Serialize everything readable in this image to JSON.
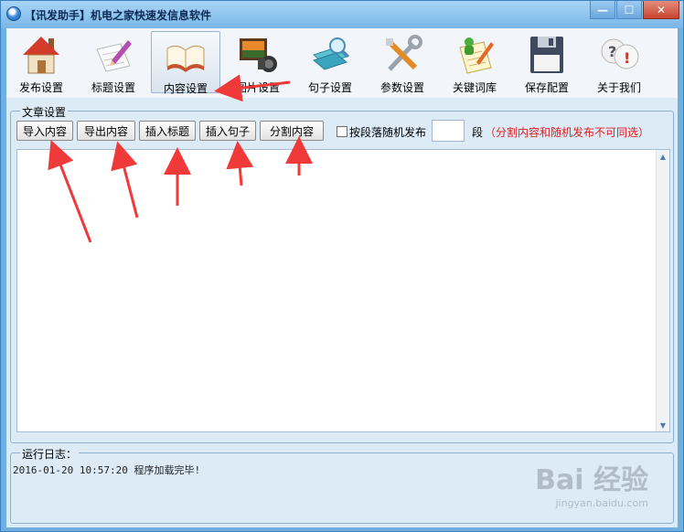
{
  "window": {
    "title": "【讯发助手】机电之家快速发信息软件",
    "controls": {
      "minimize": "—",
      "maximize": "☐",
      "close": "✕"
    }
  },
  "toolbar": {
    "items": [
      {
        "label": "发布设置",
        "icon": "house-icon"
      },
      {
        "label": "标题设置",
        "icon": "pencil-note-icon"
      },
      {
        "label": "内容设置",
        "icon": "open-book-icon",
        "active": true
      },
      {
        "label": "图片设置",
        "icon": "photo-camera-icon"
      },
      {
        "label": "句子设置",
        "icon": "magnifier-book-icon"
      },
      {
        "label": "参数设置",
        "icon": "tools-icon"
      },
      {
        "label": "关键词库",
        "icon": "user-checklist-icon"
      },
      {
        "label": "保存配置",
        "icon": "floppy-disk-icon"
      },
      {
        "label": "关于我们",
        "icon": "help-icon"
      }
    ]
  },
  "article": {
    "group_title": "文章设置",
    "buttons": {
      "import": "导入内容",
      "export": "导出内容",
      "insert_title": "插入标题",
      "insert_sentence": "插入句子",
      "split": "分割内容"
    },
    "random_publish": {
      "label": "按段落随机发布",
      "checked": false
    },
    "segment_value": "",
    "segment_unit": "段",
    "warning": "（分割内容和随机发布不可同选）",
    "content": ""
  },
  "log": {
    "title": "运行日志：",
    "entries": [
      "2016-01-20 10:57:20  程序加载完毕!"
    ]
  },
  "watermark": {
    "main": "Bai 经验",
    "sub": "jingyan.baidu.com"
  },
  "colors": {
    "titlebar": "#8fc4ee",
    "client_bg": "#dcebf6",
    "toolbar_bg": "#f2f6fa",
    "warning": "#e02020",
    "annotation_arrow": "#f03a3a"
  }
}
